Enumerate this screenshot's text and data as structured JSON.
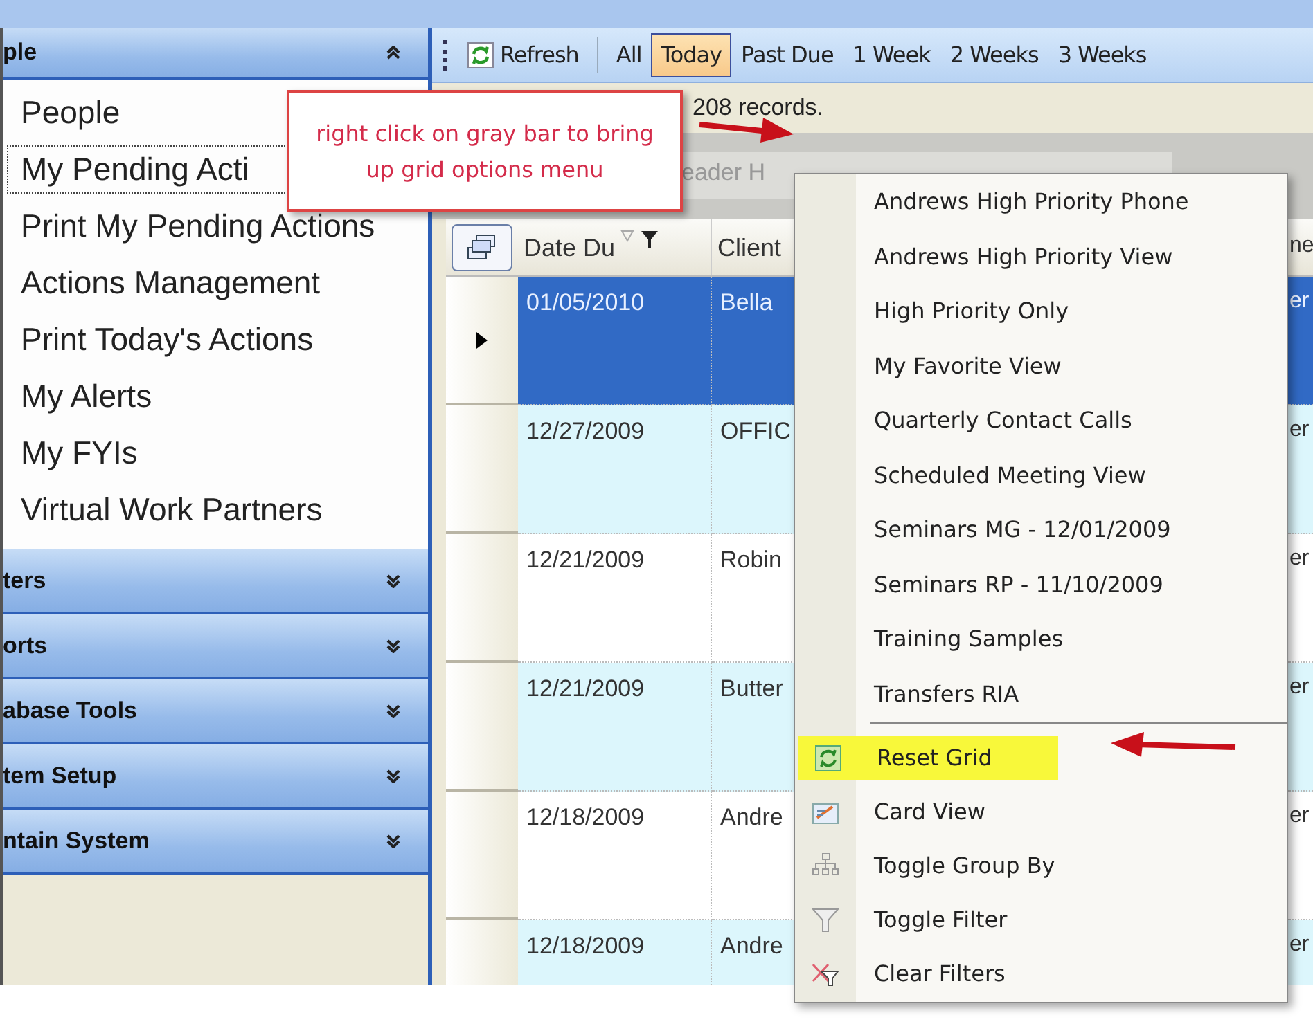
{
  "sidebar": {
    "panels": [
      {
        "title": "ple",
        "expanded": true,
        "items": [
          {
            "label": "People",
            "selected": false
          },
          {
            "label": "My Pending Acti",
            "selected": true
          },
          {
            "label": "Print My Pending Actions",
            "selected": false
          },
          {
            "label": "Actions Management",
            "selected": false
          },
          {
            "label": "Print Today's Actions",
            "selected": false
          },
          {
            "label": "My Alerts",
            "selected": false
          },
          {
            "label": "My FYIs",
            "selected": false
          },
          {
            "label": "Virtual Work Partners",
            "selected": false
          }
        ]
      },
      {
        "title": "ters",
        "expanded": false
      },
      {
        "title": "orts",
        "expanded": false
      },
      {
        "title": "abase Tools",
        "expanded": false
      },
      {
        "title": "tem Setup",
        "expanded": false
      },
      {
        "title": "ntain System",
        "expanded": false
      }
    ]
  },
  "toolbar": {
    "refresh": "Refresh",
    "filters": [
      {
        "label": "All",
        "selected": false
      },
      {
        "label": "Today",
        "selected": true
      },
      {
        "label": "Past Due",
        "selected": false
      },
      {
        "label": "1 Week",
        "selected": false
      },
      {
        "label": "2 Weeks",
        "selected": false
      },
      {
        "label": "3 Weeks",
        "selected": false
      }
    ]
  },
  "status": "208 records.",
  "group_panel": {
    "prompt": "eader H"
  },
  "grid": {
    "columns": [
      "Date Du",
      "Client",
      "ne"
    ],
    "rows": [
      {
        "cells": [
          "01/05/2010",
          "Bella",
          "er"
        ],
        "selected": true
      },
      {
        "cells": [
          "12/27/2009",
          "OFFIC",
          "er"
        ],
        "selected": false
      },
      {
        "cells": [
          "12/21/2009",
          "Robin",
          "er"
        ],
        "selected": false
      },
      {
        "cells": [
          "12/21/2009",
          "Butter",
          "er"
        ],
        "selected": false
      },
      {
        "cells": [
          "12/18/2009",
          "Andre",
          "er"
        ],
        "selected": false
      },
      {
        "cells": [
          "12/18/2009",
          "Andre",
          "er"
        ],
        "selected": false
      }
    ]
  },
  "context_menu": {
    "views": [
      "Andrews High Priority Phone",
      "Andrews High Priority View",
      "High Priority Only",
      "My Favorite View",
      "Quarterly Contact Calls",
      "Scheduled Meeting View",
      "Seminars MG - 12/01/2009",
      "Seminars RP - 11/10/2009",
      "Training Samples",
      "Transfers RIA"
    ],
    "actions": [
      {
        "label": "Reset Grid",
        "kind": "refresh",
        "highlighted": true
      },
      {
        "label": "Card View",
        "kind": "card",
        "highlighted": false
      },
      {
        "label": "Toggle Group By",
        "kind": "tree",
        "highlighted": false
      },
      {
        "label": "Toggle Filter",
        "kind": "filter",
        "highlighted": false
      },
      {
        "label": "Clear Filters",
        "kind": "clearfilter",
        "highlighted": false
      }
    ]
  },
  "callout": {
    "text": "right click on gray bar to bring up grid options menu"
  }
}
